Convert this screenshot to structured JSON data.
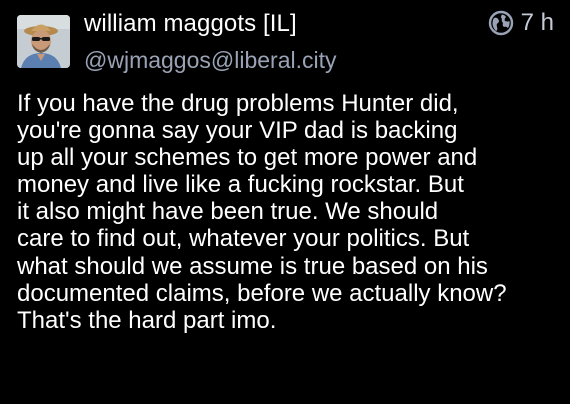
{
  "author": {
    "display_name": "william maggots [IL]",
    "handle": "@wjmaggos@liberal.city",
    "avatar_icon": "user-avatar-photo"
  },
  "meta": {
    "visibility_icon": "globe-icon",
    "timestamp": "7 h"
  },
  "post": {
    "text": "If you have the drug problems Hunter did,\nyou're gonna say your VIP dad is backing\nup all your schemes to get more power and\nmoney and live like a fucking rockstar. But\nit also might have been true. We should\ncare to find out, whatever your politics. But\nwhat should we assume is true based on his\ndocumented claims, before we actually know?\nThat's the hard part imo."
  },
  "colors": {
    "background": "#000000",
    "text": "#ffffff",
    "secondary_text": "#9aa3b5"
  }
}
